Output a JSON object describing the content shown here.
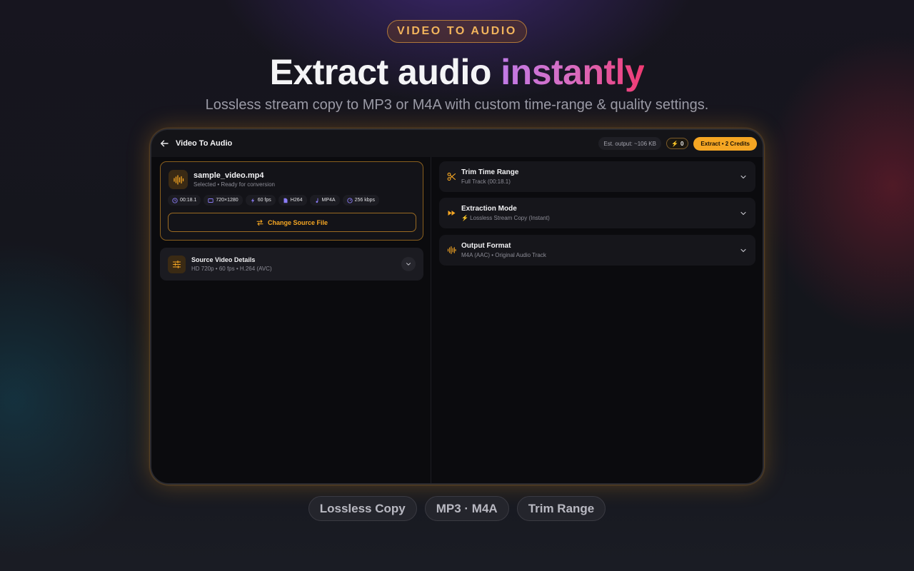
{
  "hero": {
    "badge": "VIDEO TO AUDIO",
    "title_main": "Extract audio ",
    "title_accent": "instantly",
    "subtitle": "Lossless stream copy to MP3 or M4A with custom time-range & quality settings."
  },
  "app": {
    "title": "Video To Audio",
    "est_output": "Est. output: ~106 KB",
    "credits_count": "0",
    "extract_label": "Extract • 2 Credits"
  },
  "file": {
    "name": "sample_video.mp4",
    "status": "Selected • Ready for conversion",
    "meta": [
      {
        "icon": "clock-icon",
        "text": "00:18.1"
      },
      {
        "icon": "resolution-icon",
        "text": "720×1280"
      },
      {
        "icon": "bolt-icon",
        "text": "60 fps"
      },
      {
        "icon": "codec-file-icon",
        "text": "H264"
      },
      {
        "icon": "music-note-icon",
        "text": "MP4A"
      },
      {
        "icon": "bitrate-icon",
        "text": "256 kbps"
      }
    ],
    "change_label": "Change Source File"
  },
  "details": {
    "title": "Source Video Details",
    "subtitle": "HD 720p • 60 fps • H.264 (AVC)"
  },
  "accordions": [
    {
      "icon": "scissors-icon",
      "title": "Trim Time Range",
      "subtitle": "Full Track (00:18.1)"
    },
    {
      "icon": "fast-forward-icon",
      "title": "Extraction Mode",
      "subtitle": "⚡ Lossless Stream Copy (Instant)"
    },
    {
      "icon": "waveform-icon",
      "title": "Output Format",
      "subtitle": "M4A (AAC) • Original Audio Track"
    }
  ],
  "features": [
    "Lossless Copy",
    "MP3 · M4A",
    "Trim Range"
  ],
  "colors": {
    "accent": "#f5a623",
    "purple": "#c07ae6",
    "pink": "#f03a72",
    "meta_icon": "#8b7cf6"
  }
}
